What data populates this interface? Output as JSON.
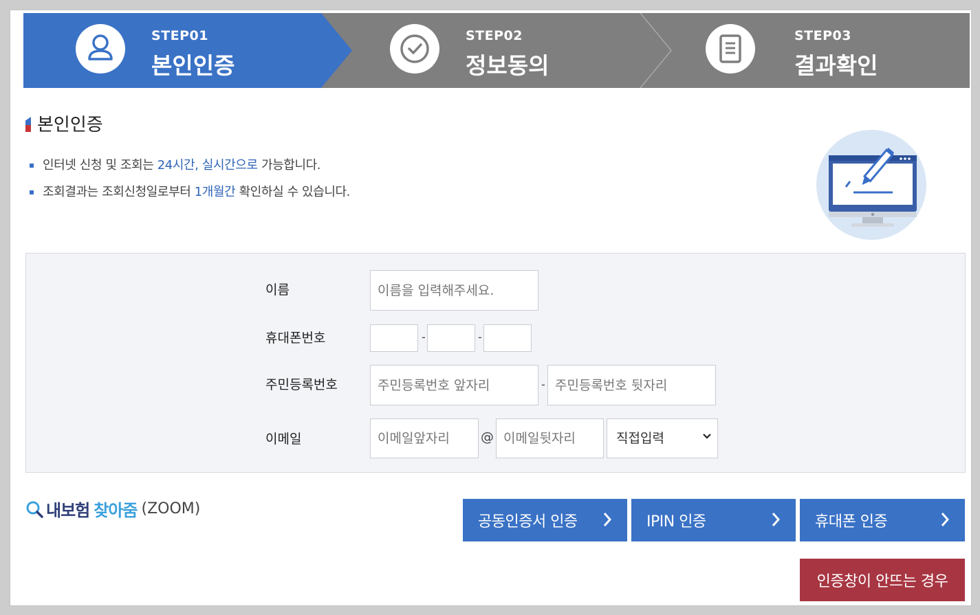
{
  "steps": [
    {
      "num": "STEP01",
      "name": "본인인증",
      "icon": "person-icon",
      "active": true
    },
    {
      "num": "STEP02",
      "name": "정보동의",
      "icon": "check-circle-icon",
      "active": false
    },
    {
      "num": "STEP03",
      "name": "결과확인",
      "icon": "document-icon",
      "active": false
    }
  ],
  "colors": {
    "active_step": "#3a72c6",
    "inactive_step": "#7f7f7f",
    "button": "#3a72c6",
    "button_alt": "#a83642",
    "highlight": "#2f64b8"
  },
  "section": {
    "title": "본인인증"
  },
  "notes": {
    "n1": {
      "pre": "인터넷 신청 및 조회는 ",
      "h1": "24시간",
      "mid": ", ",
      "h2": "실시간으로",
      "post": " 가능합니다."
    },
    "n2": {
      "pre": "조회결과는 조회신청일로부터 ",
      "h1": "1개월간",
      "post": " 확인하실 수 있습니다."
    }
  },
  "form": {
    "name_label": "이름",
    "name_placeholder": "이름을 입력해주세요.",
    "phone_label": "휴대폰번호",
    "phone_sep": "-",
    "rrn_label": "주민등록번호",
    "rrn_front_placeholder": "주민등록번호 앞자리",
    "rrn_back_placeholder": "주민등록번호 뒷자리",
    "email_label": "이메일",
    "email_front_placeholder": "이메일앞자리",
    "email_at": "@",
    "email_back_placeholder": "이메일뒷자리",
    "email_domain_selected": "직접입력"
  },
  "logo": {
    "part1": "내보험",
    "part2": "찾아줌",
    "part3": "(ZOOM)"
  },
  "buttons": {
    "cert": "공동인증서 인증",
    "ipin": "IPIN 인증",
    "phone": "휴대폰 인증",
    "no_popup": "인증창이 안뜨는 경우"
  }
}
